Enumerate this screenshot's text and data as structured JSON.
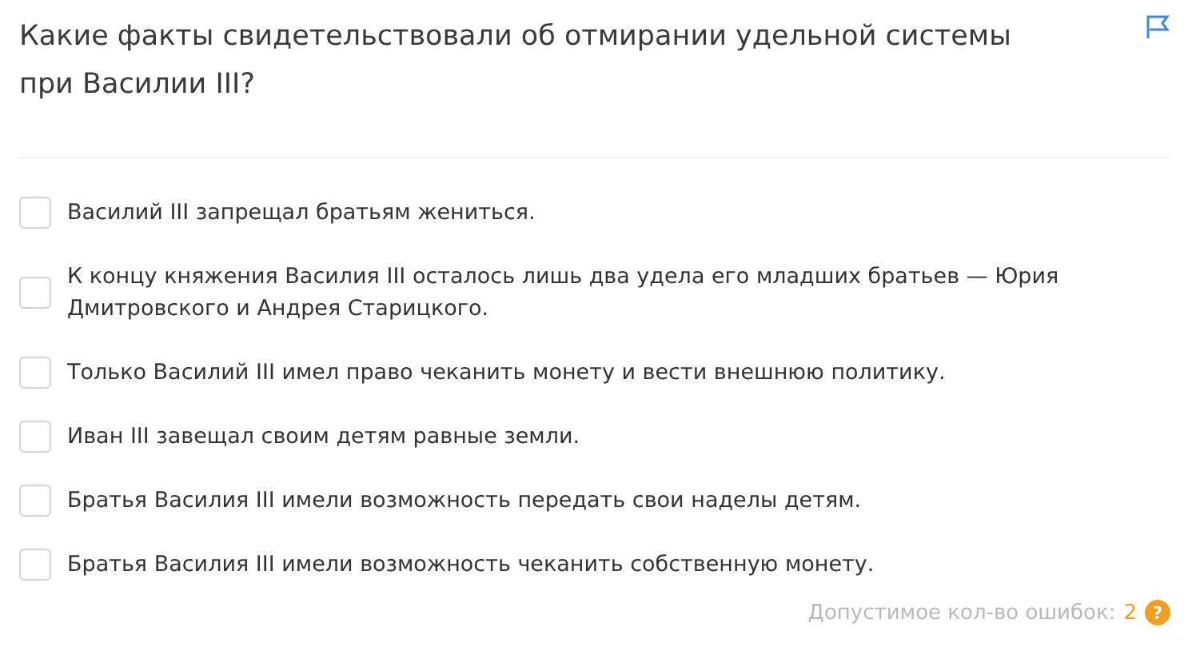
{
  "question": "Какие факты свидетельствовали об отмирании удельной системы при Василии III?",
  "options": [
    {
      "text": "Василий III запрещал братьям жениться.",
      "checked": false
    },
    {
      "text": "К концу княжения Василия III осталось лишь два удела его младших братьев — Юрия Дмитровского и Андрея Старицкого.",
      "checked": false
    },
    {
      "text": "Только Василий III имел право чеканить монету и вести внешнюю политику.",
      "checked": false
    },
    {
      "text": "Иван III завещал своим детям равные земли.",
      "checked": false
    },
    {
      "text": "Братья Василия III имели возможность передать свои наделы детям.",
      "checked": false
    },
    {
      "text": "Братья Василия III имели возможность чеканить собственную монету.",
      "checked": false
    }
  ],
  "footer": {
    "label": "Допустимое кол-во ошибок:",
    "count": "2",
    "badge": "?"
  }
}
